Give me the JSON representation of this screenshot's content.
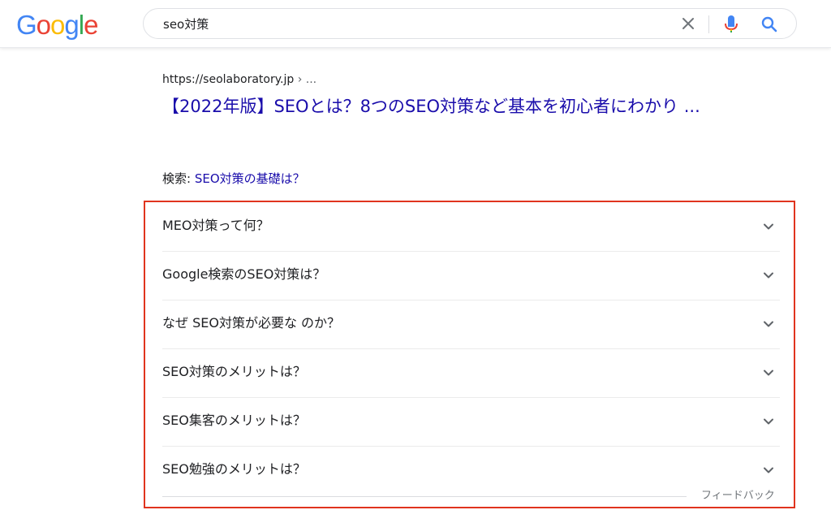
{
  "header": {
    "logo_letters": [
      {
        "char": "G",
        "color": "#4285F4"
      },
      {
        "char": "o",
        "color": "#EA4335"
      },
      {
        "char": "o",
        "color": "#FBBC05"
      },
      {
        "char": "g",
        "color": "#4285F4"
      },
      {
        "char": "l",
        "color": "#34A853"
      },
      {
        "char": "e",
        "color": "#EA4335"
      }
    ],
    "search": {
      "value": "seo対策",
      "clear_icon": "close-icon",
      "mic_icon": "microphone-icon",
      "search_icon": "search-icon"
    }
  },
  "result": {
    "url": "https://seolaboratory.jp",
    "breadcrumb": " › ...",
    "title": "【2022年版】SEOとは？8つのSEO対策など基本を初心者にわかり ..."
  },
  "search_for": {
    "label": "検索: ",
    "query": "SEO対策の基礎は？"
  },
  "paa": {
    "items": [
      {
        "question": "MEO対策って何？"
      },
      {
        "question": "Google検索のSEO対策は？"
      },
      {
        "question": "なぜ SEO対策が必要な のか？"
      },
      {
        "question": "SEO対策のメリットは？"
      },
      {
        "question": "SEO集客のメリットは？"
      },
      {
        "question": "SEO勉強のメリットは？"
      }
    ],
    "feedback": "フィードバック",
    "highlight_color": "#e0341e"
  },
  "colors": {
    "link": "#1a0dab",
    "text": "#202124",
    "muted": "#70757a"
  }
}
